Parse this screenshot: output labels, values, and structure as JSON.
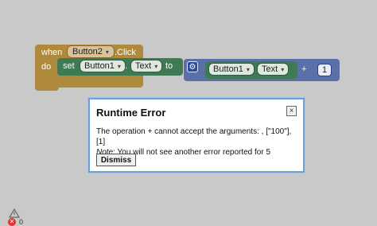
{
  "event_block": {
    "when_label": "when",
    "component": "Button2",
    "event": ".Click",
    "do_label": "do"
  },
  "set_block": {
    "set_label": "set",
    "component": "Button1",
    "dot": ".",
    "property": "Text",
    "to_label": "to"
  },
  "math_block": {
    "getter_component": "Button1",
    "dot": ".",
    "getter_property": "Text",
    "operator": "+",
    "number": "1"
  },
  "dialog": {
    "title": "Runtime Error",
    "close_symbol": "×",
    "message_line1": "The operation + cannot accept the arguments: , [\"100\"], [1]",
    "note_label": "Note",
    "message_line2": ": You will not see another error reported for 5 seconds.",
    "dismiss_label": "Dismiss"
  },
  "status": {
    "error_count": "0"
  },
  "colors": {
    "event": "#b08a3c",
    "set": "#3f7a55",
    "math": "#5b6fa8",
    "dialog_border": "#6e9fd6"
  }
}
